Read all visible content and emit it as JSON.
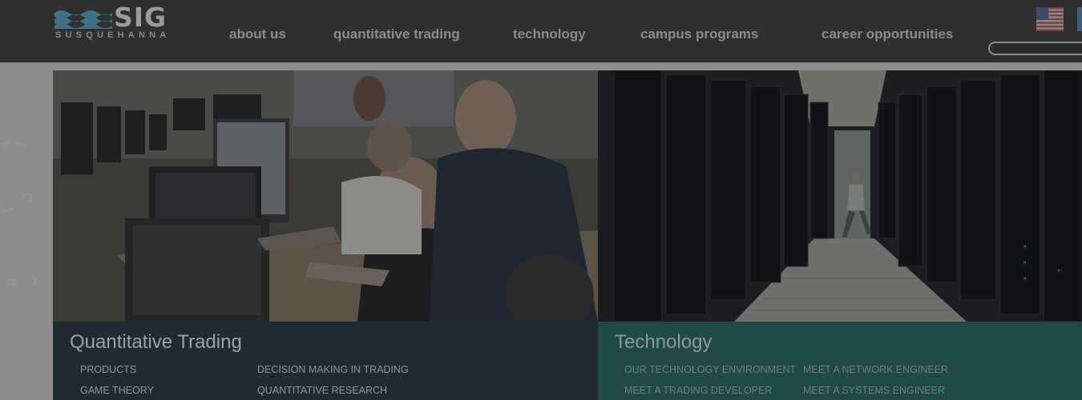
{
  "header": {
    "logo": {
      "wordmark": "SIG",
      "subtitle": "SUSQUEHANNA"
    },
    "nav": [
      {
        "label": "about us"
      },
      {
        "label": "quantitative trading"
      },
      {
        "label": "technology"
      },
      {
        "label": "campus programs"
      },
      {
        "label": "career opportunities"
      }
    ],
    "flag_icon": "us-flag-icon",
    "search": {
      "placeholder": "",
      "value": ""
    }
  },
  "panels": {
    "quant_trading": {
      "title": "Quantitative Trading",
      "links": [
        "PRODUCTS",
        "DECISION MAKING IN TRADING",
        "GAME THEORY",
        "QUANTITATIVE RESEARCH"
      ]
    },
    "technology": {
      "title": "Technology",
      "links": [
        "OUR TECHNOLOGY ENVIRONMENT",
        "MEET A NETWORK ENGINEER",
        "MEET A TRADING DEVELOPER",
        "MEET A SYSTEMS ENGINEER"
      ]
    }
  },
  "colors": {
    "topbar": "#2f2f2f",
    "page_overlay": "#8d8d8d",
    "quant_panel": "#1f2a33",
    "tech_panel": "#1f4a47"
  }
}
